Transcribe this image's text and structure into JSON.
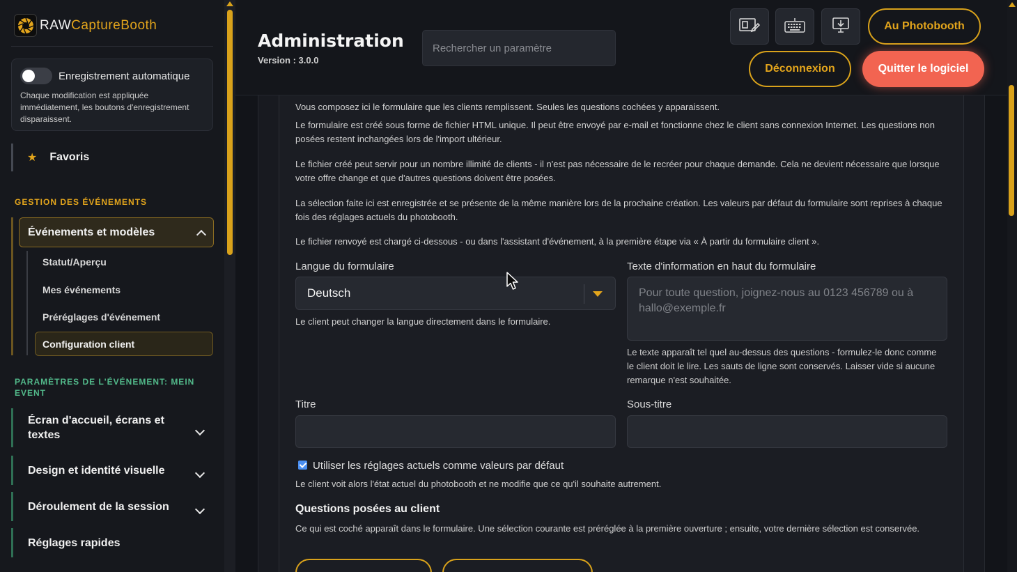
{
  "app": {
    "logo_raw": "RAW",
    "logo_capture": "CaptureBooth"
  },
  "autosave": {
    "title": "Enregistrement automatique",
    "description": "Chaque modification est appliquée immédiatement, les boutons d'enregistrement disparaissent."
  },
  "favorites": {
    "label": "Favoris"
  },
  "nav": {
    "section_events": "GESTION DES ÉVÉNEMENTS",
    "events_group": "Événements et modèles",
    "sub_items": [
      "Statut/Aperçu",
      "Mes événements",
      "Préréglages d'événement",
      "Configuration client"
    ],
    "section_params": "PARAMÈTRES DE L'ÉVÉNEMENT: MEIN EVENT",
    "param_items": [
      "Écran d'accueil, écrans et textes",
      "Design et identité visuelle",
      "Déroulement de la session",
      "Réglages rapides"
    ]
  },
  "header": {
    "title": "Administration",
    "version": "Version : 3.0.0",
    "search_placeholder": "Rechercher un paramètre",
    "btn_photobooth": "Au Photobooth",
    "btn_logout": "Déconnexion",
    "btn_quit": "Quitter le logiciel"
  },
  "content": {
    "paragraphs": [
      "Vous composez ici le formulaire que les clients remplissent. Seules les questions cochées y apparaissent.",
      "Le formulaire est créé sous forme de fichier HTML unique. Il peut être envoyé par e-mail et fonctionne chez le client sans connexion Internet. Les questions non posées restent inchangées lors de l'import ultérieur.",
      "Le fichier créé peut servir pour un nombre illimité de clients - il n'est pas nécessaire de le recréer pour chaque demande. Cela ne devient nécessaire que lorsque votre offre change et que d'autres questions doivent être posées.",
      "La sélection faite ici est enregistrée et se présente de la même manière lors de la prochaine création. Les valeurs par défaut du formulaire sont reprises à chaque fois des réglages actuels du photobooth.",
      "Le fichier renvoyé est chargé ci-dessous - ou dans l'assistant d'événement, à la première étape via « À partir du formulaire client »."
    ],
    "lang_label": "Langue du formulaire",
    "lang_value": "Deutsch",
    "lang_help": "Le client peut changer la langue directement dans le formulaire.",
    "info_label": "Texte d'information en haut du formulaire",
    "info_placeholder": "Pour toute question, joignez-nous au 0123 456789 ou à hallo@exemple.fr",
    "info_help": "Le texte apparaît tel quel au-dessus des questions - formulez-le donc comme le client doit le lire. Les sauts de ligne sont conservés. Laisser vide si aucune remarque n'est souhaitée.",
    "title_label": "Titre",
    "subtitle_label": "Sous-titre",
    "defaults_checkbox": "Utiliser les réglages actuels comme valeurs par défaut",
    "defaults_help": "Le client voit alors l'état actuel du photobooth et ne modifie que ce qu'il souhaite autrement.",
    "questions_title": "Questions posées au client",
    "questions_help": "Ce qui est coché apparaît dans le formulaire. Une sélection courante est préréglée à la première ouverture ; ensuite, votre dernière sélection est conservée."
  },
  "colors": {
    "accent": "#e3a51c",
    "danger": "#f26451",
    "green": "#52b98a"
  }
}
